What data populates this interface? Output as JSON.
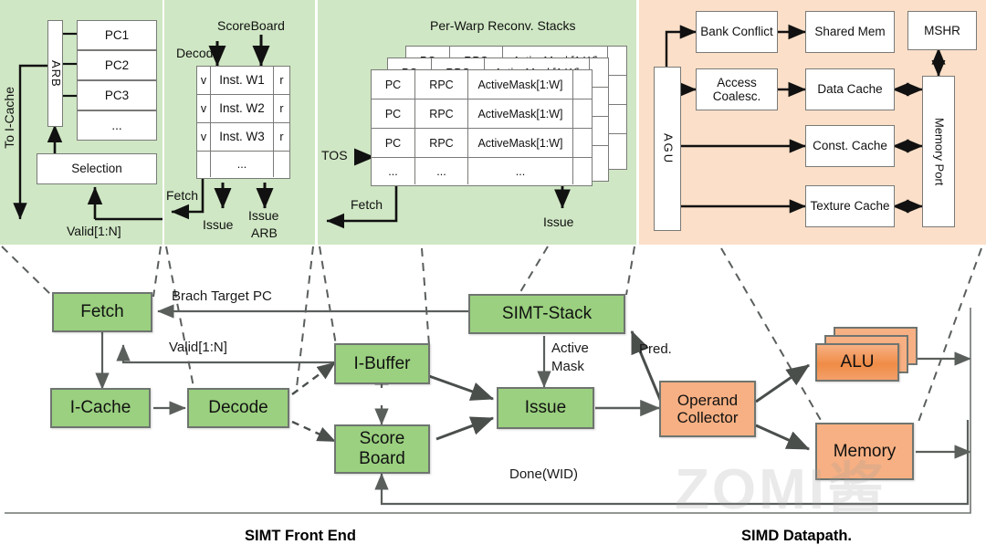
{
  "panels": {
    "fetch_panel": {
      "arb_label": "ARB",
      "pcs": [
        "PC1",
        "PC2",
        "PC3",
        "..."
      ],
      "selection": "Selection",
      "to_icache": "To I-Cache",
      "valid": "Valid[1:N]"
    },
    "ibuffer_panel": {
      "scoreboard": "ScoreBoard",
      "decode": "Decode",
      "rows": [
        {
          "v": "v",
          "inst": "Inst. W1",
          "r": "r"
        },
        {
          "v": "v",
          "inst": "Inst. W2",
          "r": "r"
        },
        {
          "v": "v",
          "inst": "Inst. W3",
          "r": "r"
        },
        {
          "v": "",
          "inst": "...",
          "r": ""
        }
      ],
      "fetch": "Fetch",
      "issue": "Issue",
      "issue_arb_1": "Issue",
      "issue_arb_2": "ARB"
    },
    "stack_panel": {
      "title": "Per-Warp Reconv. Stacks",
      "headers": [
        "PC",
        "RPC",
        "ActiveMask[1:W]"
      ],
      "rows": [
        [
          "PC",
          "RPC",
          "ActiveMask[1:W]"
        ],
        [
          "PC",
          "RPC",
          "ActiveMask[1:W]"
        ],
        [
          "PC",
          "RPC",
          "ActiveMask[1:W]"
        ],
        [
          "...",
          "...",
          "..."
        ]
      ],
      "tos": "TOS",
      "fetch": "Fetch",
      "issue": "Issue"
    },
    "memory_panel": {
      "agu": "AGU",
      "bank_conflict": "Bank Conflict",
      "shared_mem": "Shared Mem",
      "access_coalesc": "Access Coalesc.",
      "data_cache": "Data Cache",
      "const_cache": "Const. Cache",
      "texture_cache": "Texture Cache",
      "mshr": "MSHR",
      "memory_port": "Memory Port"
    }
  },
  "main": {
    "nodes": {
      "fetch": "Fetch",
      "icache": "I-Cache",
      "decode": "Decode",
      "ibuffer": "I-Buffer",
      "scoreboard": "Score Board",
      "simt_stack": "SIMT-Stack",
      "issue": "Issue",
      "operand_collector": "Operand Collector",
      "alu": "ALU",
      "memory": "Memory"
    },
    "edge_labels": {
      "branch_target_pc": "Brach Target PC",
      "valid": "Valid[1:N]",
      "active_mask_1": "Active",
      "active_mask_2": "Mask",
      "pred": "Pred.",
      "done_wid": "Done(WID)"
    },
    "sections": {
      "front_end": "SIMT Front End",
      "datapath": "SIMD Datapath."
    }
  },
  "watermark": "ZOMI酱",
  "colors": {
    "green_panel": "#cfe7c4",
    "orange_panel": "#fbdfc8",
    "green_node": "#9ad07f",
    "orange_node": "#f7b083",
    "alu_node": "#ef8c47",
    "border": "#6f7570",
    "line": "#5a5f5c"
  }
}
